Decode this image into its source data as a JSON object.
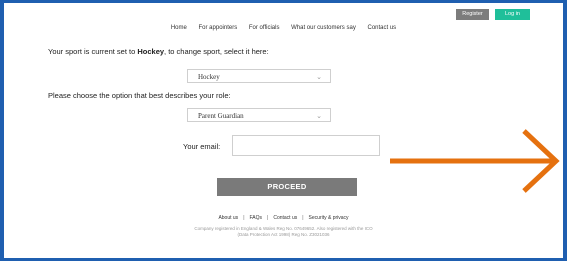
{
  "header": {
    "nav": [
      "Home",
      "For appointers",
      "For officials",
      "What our customers say",
      "Contact us"
    ],
    "register_label": "Register",
    "login_label": "Log in"
  },
  "sport": {
    "prompt_prefix": "Your sport is current set to ",
    "selected_sport": "Hockey",
    "prompt_suffix": ", to change sport, select it here:",
    "select_value": "Hockey"
  },
  "role": {
    "prompt": "Please choose the option that best describes your role:",
    "select_value": "Parent Guardian"
  },
  "email": {
    "label": "Your email:",
    "value": ""
  },
  "proceed_label": "PROCEED",
  "footer": {
    "links": [
      "About us",
      "FAQs",
      "Contact us",
      "Security & privacy"
    ],
    "note_line1": "Company registered in England & Wales Reg No. 07649652. Also registered with the ICO",
    "note_line2": "(Data Protection Act 1998) Reg No. Z3021036"
  },
  "colors": {
    "border": "#1f5fb0",
    "login": "#1fbf9a",
    "register": "#7c7c7c",
    "proceed": "#7a7a7a",
    "arrow": "#e5710f"
  },
  "icons": {
    "select_chevron": "chevron-down-icon",
    "annotation": "arrow-right-icon"
  }
}
